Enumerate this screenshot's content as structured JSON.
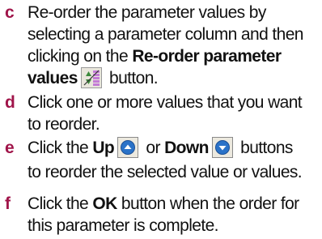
{
  "steps": [
    {
      "marker": "c",
      "line1": "Re-order the parameter values by",
      "line2": "selecting a parameter column and then",
      "line3_pre": "clicking on the ",
      "line3_bold": "Re-order parameter",
      "line4_bold": "values",
      "line4_post": " button."
    },
    {
      "marker": "d",
      "line1": "Click one or more values that you want",
      "line2": "to reorder."
    },
    {
      "marker": "e",
      "line1_pre": "Click the ",
      "line1_up": "Up",
      "line1_mid": " or ",
      "line1_down": "Down",
      "line1_post": " buttons",
      "line2": "to reorder the selected value or values."
    },
    {
      "marker": "f",
      "line1_pre": "Click the ",
      "line1_ok": "OK",
      "line1_post": " button when the order for",
      "line2": "this parameter is complete."
    }
  ],
  "icons": {
    "reorder": "reorder-parameter-values-icon",
    "up": "up-arrow-button-icon",
    "down": "down-arrow-button-icon"
  },
  "colors": {
    "marker": "#a0154a",
    "text": "#111111",
    "icon_blue": "#2a72c8",
    "icon_frame": "#7a7a7a"
  }
}
